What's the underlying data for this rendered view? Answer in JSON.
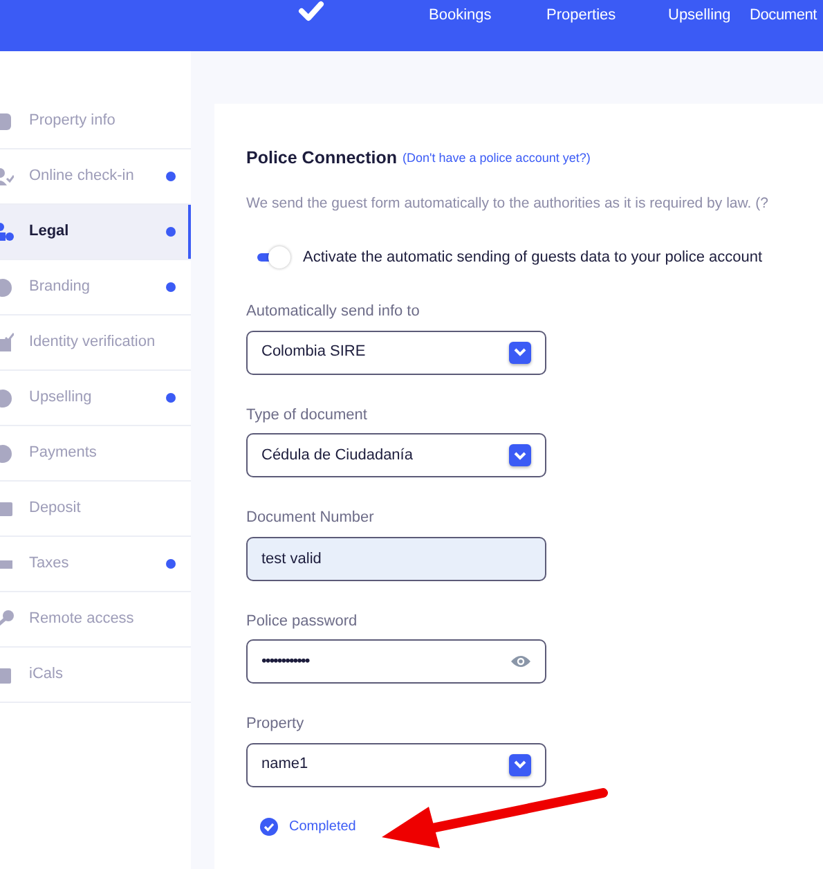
{
  "header": {
    "nav": [
      {
        "label": "Bookings"
      },
      {
        "label": "Properties"
      },
      {
        "label": "Upselling"
      },
      {
        "label": "Document"
      }
    ]
  },
  "sidebar": {
    "items": [
      {
        "label": "Property info",
        "selected": false,
        "dot": false
      },
      {
        "label": "Online check-in",
        "selected": false,
        "dot": true
      },
      {
        "label": "Legal",
        "selected": true,
        "dot": true
      },
      {
        "label": "Branding",
        "selected": false,
        "dot": true
      },
      {
        "label": "Identity verification",
        "selected": false,
        "dot": false
      },
      {
        "label": "Upselling",
        "selected": false,
        "dot": true
      },
      {
        "label": "Payments",
        "selected": false,
        "dot": false
      },
      {
        "label": "Deposit",
        "selected": false,
        "dot": false
      },
      {
        "label": "Taxes",
        "selected": false,
        "dot": true
      },
      {
        "label": "Remote access",
        "selected": false,
        "dot": false
      },
      {
        "label": "iCals",
        "selected": false,
        "dot": false
      }
    ]
  },
  "police": {
    "title": "Police Connection",
    "link": "(Don't have a police account yet?)",
    "description": "We send the guest form automatically to the authorities as it is required by law. (?",
    "toggle": {
      "label": "Activate the automatic sending of guests data to your police account",
      "on": true
    },
    "fields": [
      {
        "kind": "select",
        "label": "Automatically send info to",
        "value": "Colombia SIRE"
      },
      {
        "kind": "select",
        "label": "Type of document",
        "value": "Cédula de Ciudadanía"
      },
      {
        "kind": "text",
        "label": "Document Number",
        "value": "test valid"
      },
      {
        "kind": "password",
        "label": "Police password",
        "value": "••••••••••••"
      },
      {
        "kind": "select",
        "label": "Property",
        "value": "name1"
      }
    ],
    "status": {
      "label": "Completed",
      "completed": true
    }
  }
}
